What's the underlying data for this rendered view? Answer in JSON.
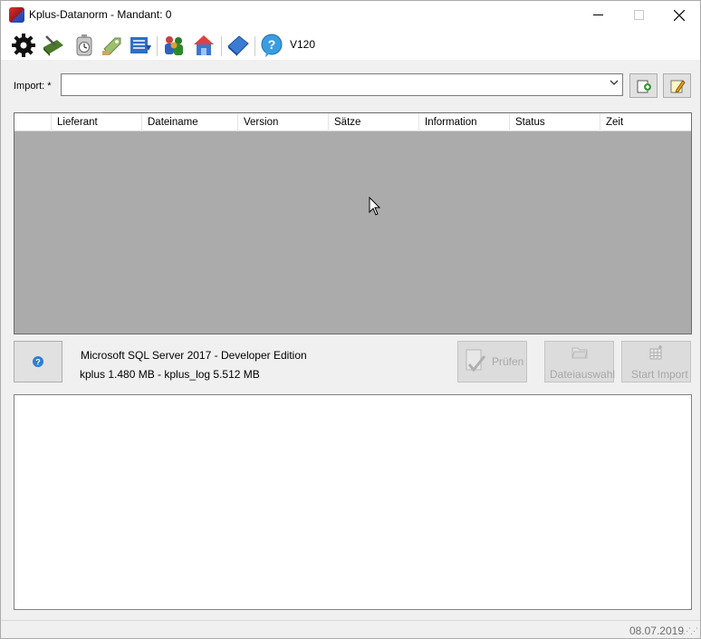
{
  "window": {
    "title": "Kplus-Datanorm - Mandant: 0",
    "minimize_glyph": "—",
    "maximize_glyph": "☐",
    "close_glyph": "✕"
  },
  "toolbar": {
    "icons": [
      "settings-icon",
      "tools-icon",
      "timer-icon",
      "price-tag-icon",
      "list-icon",
      "users-icon",
      "company-icon",
      "book-icon",
      "help-icon"
    ],
    "version": "V120"
  },
  "import": {
    "label": "Import: *",
    "value": "",
    "add_icon": "add-file-icon",
    "edit_icon": "edit-icon"
  },
  "grid": {
    "columns": [
      "",
      "Lieferant",
      "Dateiname",
      "Version",
      "Sätze",
      "Information",
      "Status",
      "Zeit"
    ],
    "rows": []
  },
  "info": {
    "help_icon": "help-icon",
    "server": "Microsoft SQL Server 2017  - Developer Edition",
    "sizes": "kplus 1.480 MB - kplus_log 5.512 MB"
  },
  "actions": {
    "check": "Prüfen",
    "file_select": "Dateiauswahl",
    "start_import": "Start Import"
  },
  "status": {
    "date": "08.07.2019"
  },
  "colors": {
    "grid_background": "#ababab",
    "window_background": "#f0f0f0",
    "disabled_text": "#a8a8a8"
  }
}
